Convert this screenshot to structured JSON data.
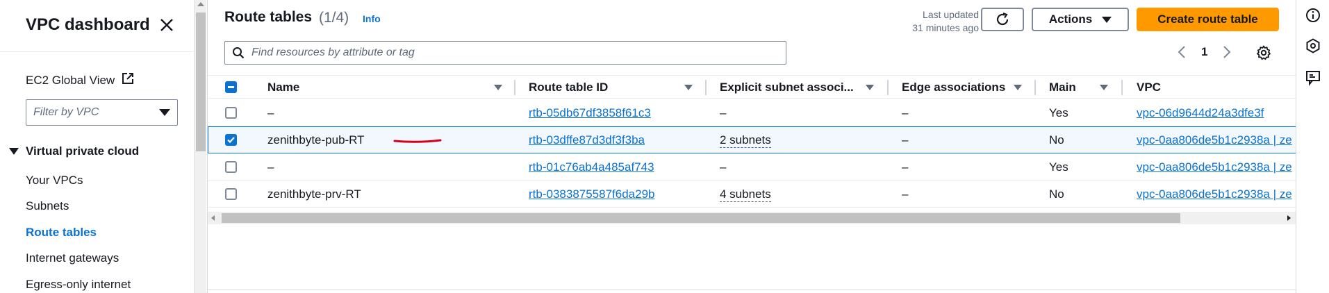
{
  "sidebar": {
    "title": "VPC dashboard",
    "ec2_link": "EC2 Global View",
    "filter_placeholder": "Filter by VPC",
    "section": "Virtual private cloud",
    "items": [
      {
        "label": "Your VPCs",
        "active": false
      },
      {
        "label": "Subnets",
        "active": false
      },
      {
        "label": "Route tables",
        "active": true
      },
      {
        "label": "Internet gateways",
        "active": false
      },
      {
        "label": "Egress-only internet",
        "active": false
      }
    ]
  },
  "header": {
    "title": "Route tables",
    "count": "(1/4)",
    "info": "Info",
    "last_updated_line1": "Last updated",
    "last_updated_line2": "31 minutes ago",
    "actions_label": "Actions",
    "create_label": "Create route table"
  },
  "search": {
    "placeholder": "Find resources by attribute or tag"
  },
  "pagination": {
    "current_page": "1"
  },
  "table": {
    "columns": [
      "Name",
      "Route table ID",
      "Explicit subnet associ...",
      "Edge associations",
      "Main",
      "VPC"
    ],
    "rows": [
      {
        "selected": false,
        "name": "–",
        "id": "rtb-05db67df3858f61c3",
        "subnets": "–",
        "edge": "–",
        "main": "Yes",
        "vpc": "vpc-06d9644d24a3dfe3f"
      },
      {
        "selected": true,
        "name": "zenithbyte-pub-RT",
        "id": "rtb-03dffe87d3df3f3ba",
        "subnets": "2 subnets",
        "edge": "–",
        "main": "No",
        "vpc": "vpc-0aa806de5b1c2938a | ze"
      },
      {
        "selected": false,
        "name": "–",
        "id": "rtb-01c76ab4a485af743",
        "subnets": "–",
        "edge": "–",
        "main": "Yes",
        "vpc": "vpc-0aa806de5b1c2938a | ze"
      },
      {
        "selected": false,
        "name": "zenithbyte-prv-RT",
        "id": "rtb-0383875587f6da29b",
        "subnets": "4 subnets",
        "edge": "–",
        "main": "No",
        "vpc": "vpc-0aa806de5b1c2938a | ze"
      }
    ]
  },
  "colors": {
    "accent": "#0972d3",
    "primary_button": "#ff9900",
    "annotation": "#d0021b"
  },
  "icons": [
    "close-icon",
    "external-link-icon",
    "search-icon",
    "refresh-icon",
    "settings-icon",
    "info-icon",
    "hexagon-icon",
    "feedback-icon"
  ]
}
